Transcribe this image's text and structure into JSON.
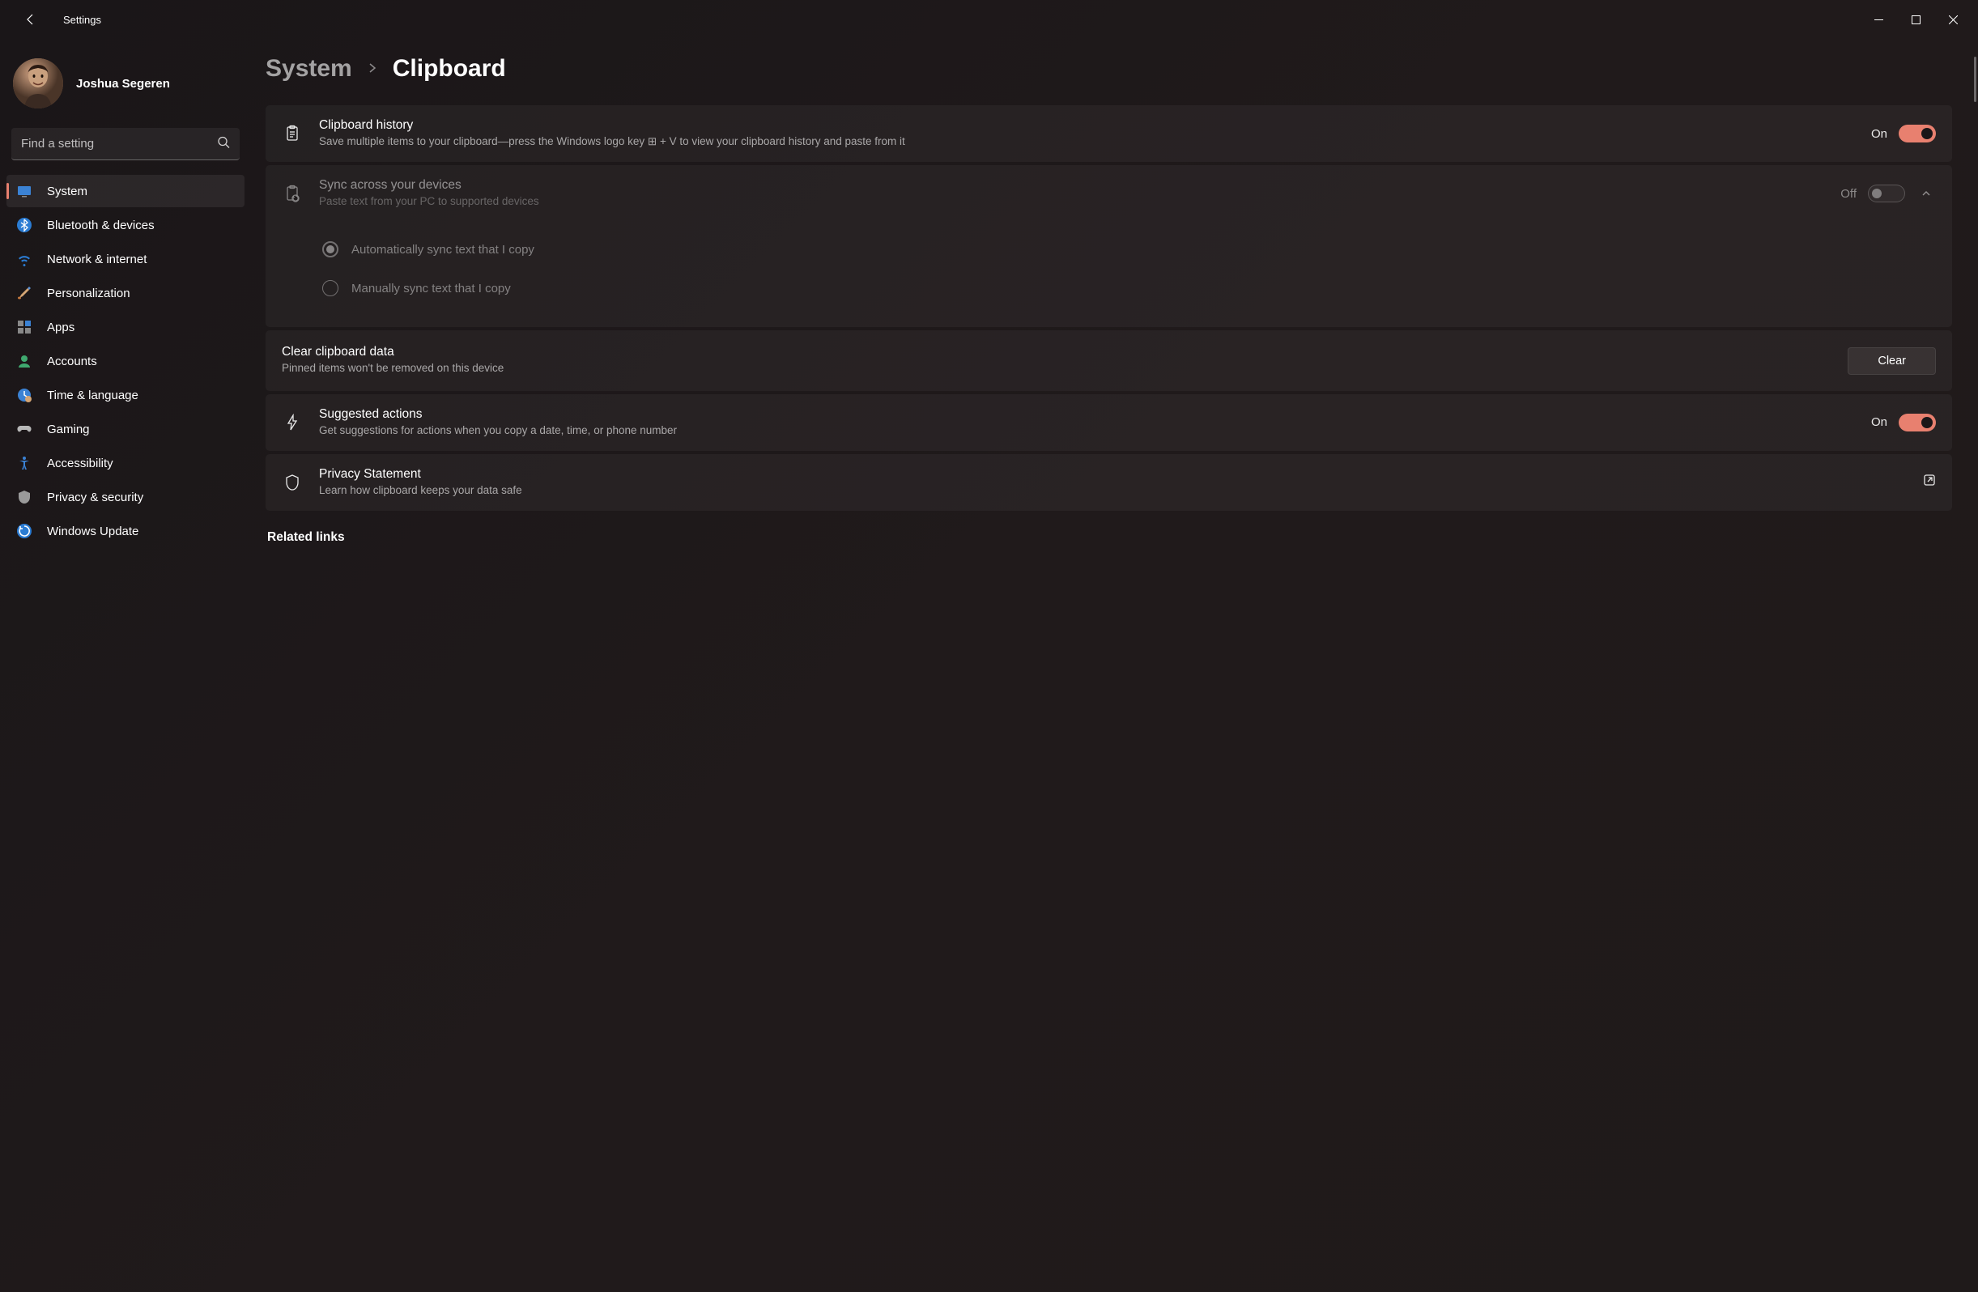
{
  "titlebar": {
    "title": "Settings"
  },
  "user": {
    "name": "Joshua Segeren"
  },
  "search": {
    "placeholder": "Find a setting"
  },
  "sidebar": {
    "items": [
      {
        "label": "System"
      },
      {
        "label": "Bluetooth & devices"
      },
      {
        "label": "Network & internet"
      },
      {
        "label": "Personalization"
      },
      {
        "label": "Apps"
      },
      {
        "label": "Accounts"
      },
      {
        "label": "Time & language"
      },
      {
        "label": "Gaming"
      },
      {
        "label": "Accessibility"
      },
      {
        "label": "Privacy & security"
      },
      {
        "label": "Windows Update"
      }
    ]
  },
  "breadcrumb": {
    "parent": "System",
    "current": "Clipboard"
  },
  "cards": {
    "history": {
      "title": "Clipboard history",
      "desc": "Save multiple items to your clipboard—press the Windows logo key ⊞ + V to view your clipboard history and paste from it",
      "state": "On"
    },
    "sync": {
      "title": "Sync across your devices",
      "desc": "Paste text from your PC to supported devices",
      "state": "Off",
      "options": {
        "auto": "Automatically sync text that I copy",
        "manual": "Manually sync text that I copy"
      }
    },
    "clear": {
      "title": "Clear clipboard data",
      "desc": "Pinned items won't be removed on this device",
      "button": "Clear"
    },
    "suggested": {
      "title": "Suggested actions",
      "desc": "Get suggestions for actions when you copy a date, time, or phone number",
      "state": "On"
    },
    "privacy": {
      "title": "Privacy Statement",
      "desc": "Learn how clipboard keeps your data safe"
    }
  },
  "related": {
    "heading": "Related links"
  }
}
